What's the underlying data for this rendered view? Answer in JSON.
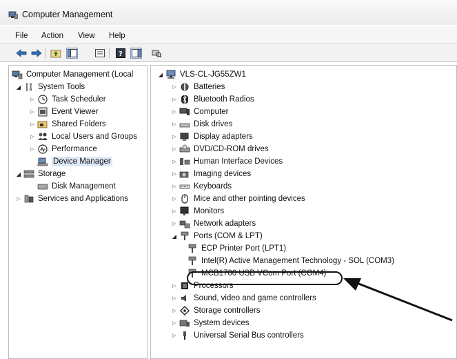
{
  "window": {
    "title": "Computer Management"
  },
  "menu": [
    "File",
    "Action",
    "View",
    "Help"
  ],
  "left_tree": [
    {
      "label": "Computer Management (Local",
      "level": 0,
      "expand": "none",
      "icon": "computer-mgmt-icon"
    },
    {
      "label": "System Tools",
      "level": 1,
      "expand": "open",
      "icon": "tools-icon"
    },
    {
      "label": "Task Scheduler",
      "level": 2,
      "expand": "closed",
      "icon": "clock-icon"
    },
    {
      "label": "Event Viewer",
      "level": 2,
      "expand": "closed",
      "icon": "event-viewer-icon"
    },
    {
      "label": "Shared Folders",
      "level": 2,
      "expand": "closed",
      "icon": "shared-folder-icon"
    },
    {
      "label": "Local Users and Groups",
      "level": 2,
      "expand": "closed",
      "icon": "users-icon"
    },
    {
      "label": "Performance",
      "level": 2,
      "expand": "closed",
      "icon": "performance-icon"
    },
    {
      "label": "Device Manager",
      "level": 2,
      "expand": "none",
      "icon": "device-manager-icon",
      "selected": true
    },
    {
      "label": "Storage",
      "level": 1,
      "expand": "open",
      "icon": "storage-icon"
    },
    {
      "label": "Disk Management",
      "level": 2,
      "expand": "none",
      "icon": "disk-icon"
    },
    {
      "label": "Services and Applications",
      "level": 1,
      "expand": "closed",
      "icon": "services-icon"
    }
  ],
  "device_tree": {
    "root": "VLS-CL-JG55ZW1",
    "categories": [
      {
        "label": "Batteries",
        "icon": "battery-icon"
      },
      {
        "label": "Bluetooth Radios",
        "icon": "bluetooth-icon"
      },
      {
        "label": "Computer",
        "icon": "computer-icon"
      },
      {
        "label": "Disk drives",
        "icon": "disk-drive-icon"
      },
      {
        "label": "Display adapters",
        "icon": "display-adapter-icon"
      },
      {
        "label": "DVD/CD-ROM drives",
        "icon": "dvd-icon"
      },
      {
        "label": "Human Interface Devices",
        "icon": "hid-icon"
      },
      {
        "label": "Imaging devices",
        "icon": "camera-icon"
      },
      {
        "label": "Keyboards",
        "icon": "keyboard-icon"
      },
      {
        "label": "Mice and other pointing devices",
        "icon": "mouse-icon"
      },
      {
        "label": "Monitors",
        "icon": "monitor-icon"
      },
      {
        "label": "Network adapters",
        "icon": "network-adapter-icon"
      },
      {
        "label": "Ports (COM & LPT)",
        "icon": "port-icon",
        "expanded": true,
        "children": [
          "ECP Printer Port (LPT1)",
          "Intel(R) Active Management Technology - SOL (COM3)",
          "MCB1700 USB VCom Port (COM4)"
        ]
      },
      {
        "label": "Processors",
        "icon": "processor-icon"
      },
      {
        "label": "Sound, video and game controllers",
        "icon": "sound-icon"
      },
      {
        "label": "Storage controllers",
        "icon": "storage-controller-icon"
      },
      {
        "label": "System devices",
        "icon": "system-devices-icon"
      },
      {
        "label": "Universal Serial Bus controllers",
        "icon": "usb-icon"
      }
    ]
  }
}
